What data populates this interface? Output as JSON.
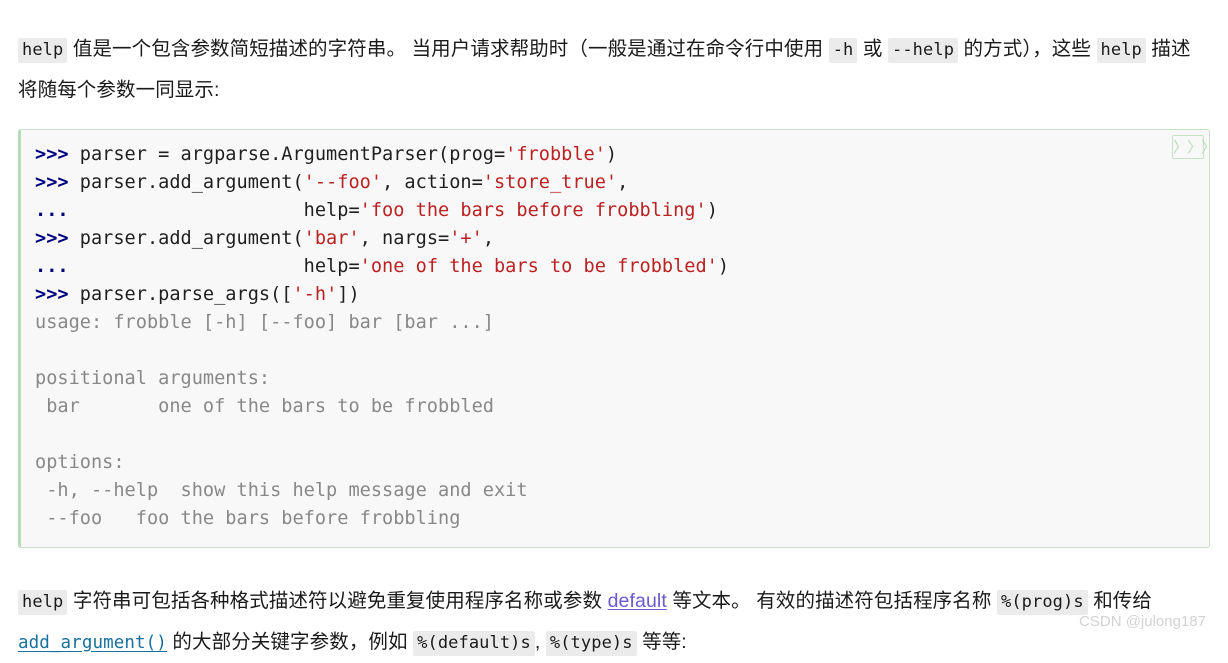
{
  "doc": {
    "language": "zh-CN",
    "paragraph_top": {
      "seg1_code": "help",
      "seg2_text": " 值是一个包含参数简短描述的字符串。 当用户请求帮助时（一般是通过在命令行中使用 ",
      "seg3_code": "-h",
      "seg4_text": " 或 ",
      "seg5_code": "--help",
      "seg6_text": " 的方式），这些 ",
      "seg7_code": "help",
      "seg8_text": " 描述将随每个参数一同显示:"
    },
    "paragraph_bottom": {
      "seg1_code": "help",
      "seg2_text": " 字符串可包括各种格式描述符以避免重复使用程序名称或参数 ",
      "seg3_link": "default",
      "seg4_text": " 等文本。 有效的描述符包括程序名称 ",
      "seg5_code": "%(prog)s",
      "seg6_text": " 和传给 ",
      "seg7_link": "add_argument()",
      "seg8_text": " 的大部分关键字参数，例如 ",
      "seg9_code": "%(default)s",
      "seg10_text": ", ",
      "seg11_code": "%(type)s",
      "seg12_text": " 等等:"
    }
  },
  "codeblock": {
    "toggle_button_label": "〉〉〉",
    "language": "python-console",
    "lines": [
      {
        "id": "line-1",
        "tokens": [
          {
            "t": ">>> ",
            "c": "tok-prompt"
          },
          {
            "t": "parser = argparse.ArgumentParser(prog=",
            "c": "tok-name"
          },
          {
            "t": "'frobble'",
            "c": "tok-str"
          },
          {
            "t": ")",
            "c": "tok-op"
          }
        ]
      },
      {
        "id": "line-2",
        "tokens": [
          {
            "t": ">>> ",
            "c": "tok-prompt"
          },
          {
            "t": "parser.add_argument(",
            "c": "tok-name"
          },
          {
            "t": "'--foo'",
            "c": "tok-str"
          },
          {
            "t": ", action=",
            "c": "tok-name"
          },
          {
            "t": "'store_true'",
            "c": "tok-str"
          },
          {
            "t": ",",
            "c": "tok-op"
          }
        ]
      },
      {
        "id": "line-3",
        "tokens": [
          {
            "t": "... ",
            "c": "tok-prompt"
          },
          {
            "t": "                    help=",
            "c": "tok-name"
          },
          {
            "t": "'foo the bars before frobbling'",
            "c": "tok-str"
          },
          {
            "t": ")",
            "c": "tok-op"
          }
        ]
      },
      {
        "id": "line-4",
        "tokens": [
          {
            "t": ">>> ",
            "c": "tok-prompt"
          },
          {
            "t": "parser.add_argument(",
            "c": "tok-name"
          },
          {
            "t": "'bar'",
            "c": "tok-str"
          },
          {
            "t": ", nargs=",
            "c": "tok-name"
          },
          {
            "t": "'+'",
            "c": "tok-str"
          },
          {
            "t": ",",
            "c": "tok-op"
          }
        ]
      },
      {
        "id": "line-5",
        "tokens": [
          {
            "t": "... ",
            "c": "tok-prompt"
          },
          {
            "t": "                    help=",
            "c": "tok-name"
          },
          {
            "t": "'one of the bars to be frobbled'",
            "c": "tok-str"
          },
          {
            "t": ")",
            "c": "tok-op"
          }
        ]
      },
      {
        "id": "line-6",
        "tokens": [
          {
            "t": ">>> ",
            "c": "tok-prompt"
          },
          {
            "t": "parser.parse_args([",
            "c": "tok-name"
          },
          {
            "t": "'-h'",
            "c": "tok-str"
          },
          {
            "t": "])",
            "c": "tok-op"
          }
        ]
      },
      {
        "id": "line-7",
        "tokens": [
          {
            "t": "usage: frobble [-h] [--foo] bar [bar ...]",
            "c": "tok-out"
          }
        ]
      },
      {
        "id": "line-8",
        "tokens": [
          {
            "t": "",
            "c": "tok-out"
          }
        ]
      },
      {
        "id": "line-9",
        "tokens": [
          {
            "t": "positional arguments:",
            "c": "tok-out"
          }
        ]
      },
      {
        "id": "line-10",
        "tokens": [
          {
            "t": " bar       one of the bars to be frobbled",
            "c": "tok-out"
          }
        ]
      },
      {
        "id": "line-11",
        "tokens": [
          {
            "t": "",
            "c": "tok-out"
          }
        ]
      },
      {
        "id": "line-12",
        "tokens": [
          {
            "t": "options:",
            "c": "tok-out"
          }
        ]
      },
      {
        "id": "line-13",
        "tokens": [
          {
            "t": " -h, --help  show this help message and exit",
            "c": "tok-out"
          }
        ]
      },
      {
        "id": "line-14",
        "tokens": [
          {
            "t": " --foo   foo the bars before frobbling",
            "c": "tok-out"
          }
        ]
      }
    ]
  },
  "watermark": {
    "text": "CSDN @julong187"
  },
  "colors": {
    "code_block_background": "#f8f8f8",
    "code_block_border": "#c7e3c7",
    "inline_code_background": "#ebebeb",
    "string_token": "#ba2121",
    "prompt_token": "#000080",
    "output_token": "#888888",
    "doc_link": "#6a5acd",
    "code_link": "#17709e",
    "watermark": "#d2d2d2"
  }
}
